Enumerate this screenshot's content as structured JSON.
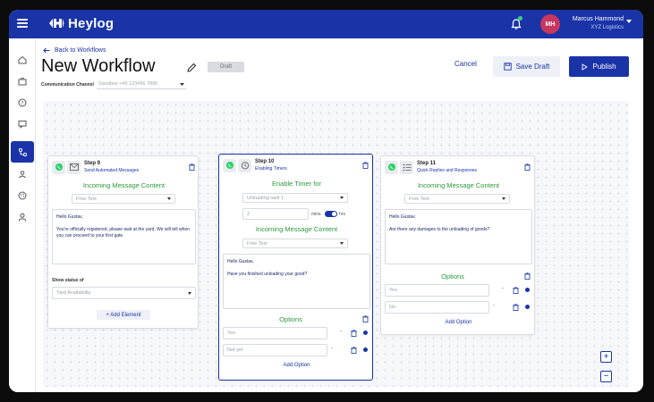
{
  "app": {
    "name": "Heylog",
    "user_initials": "MH",
    "user_name": "Marcus Hammond",
    "user_company": "XYZ Logistics"
  },
  "header": {
    "back_label": "Back to Workflows",
    "title": "New Workflow",
    "status_badge": "Draft",
    "channel_label": "Communication Channel",
    "channel_value": "Sandbox +49 123456 7890",
    "cancel_label": "Cancel",
    "save_label": "Save Draft",
    "publish_label": "Publish"
  },
  "steps": [
    {
      "title": "Step 9",
      "subtitle": "Send Automated Messages",
      "section": "Incoming Message Content",
      "content_type": "Free Text",
      "message_greeting": "Hello Gustav,",
      "message_body": "You're officially registered, please wait at the yard. We will tell when you can proceed to your first gate.",
      "status_label": "Show status of",
      "status_value": "Yard Availability",
      "add_element": "+ Add Element"
    },
    {
      "title": "Step 10",
      "subtitle": "Enabling Timers",
      "timer_title": "Enable Timer for",
      "timer_task": "Unloading task 1",
      "timer_value": "2",
      "unit_mins": "mins",
      "unit_hrs": "hrs",
      "section": "Incoming Message Content",
      "content_type": "Free Text",
      "message_greeting": "Hello Gustav,",
      "message_body": "Have you finished unloading your good?",
      "options_title": "Options",
      "options": [
        "Yes",
        "Not yet"
      ],
      "add_option": "Add Option"
    },
    {
      "title": "Step 11",
      "subtitle": "Quick Replies and Responses",
      "section": "Incoming Message Content",
      "content_type": "Free Text",
      "message_greeting": "Hello Gustav,",
      "message_body": "Are there any damages to the unloading of goods?",
      "options_title": "Options",
      "options": [
        "Yes",
        "No"
      ],
      "add_option": "Add Option"
    }
  ],
  "zoom": {
    "in": "+",
    "out": "−"
  },
  "colors": {
    "brand": "#1a34a8",
    "section_green": "#2a9a3a",
    "avatar": "#c7365f",
    "whatsapp": "#25d366"
  }
}
